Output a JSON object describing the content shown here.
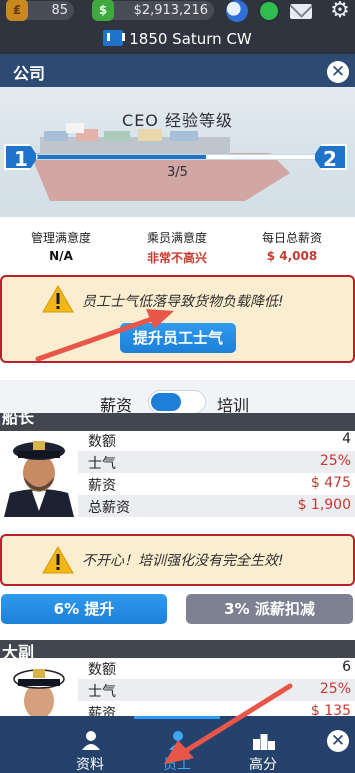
{
  "topbar": {
    "gold_amount": "85",
    "cash_amount": "$2,913,216",
    "icons": [
      "gold-icon",
      "cash-icon",
      "globe-icon",
      "status-icon",
      "mail-icon",
      "gear-icon"
    ]
  },
  "ship": {
    "name": "1850 Saturn CW"
  },
  "panel": {
    "title": "公司",
    "close_label": "✕"
  },
  "ceo": {
    "title": "CEO 经验等级",
    "level_current": "1",
    "level_next": "2",
    "progress_text": "3/5",
    "progress_fraction": 0.6
  },
  "stats": [
    {
      "label": "管理满意度",
      "value": "N/A",
      "color": "#111111"
    },
    {
      "label": "乘员满意度",
      "value": "非常不高兴",
      "color": "#c53a2f"
    },
    {
      "label": "每日总薪资",
      "value": "$ 4,008",
      "color": "#c53a2f"
    }
  ],
  "warning_top": {
    "text": "员工士气低落导致货物负载降低!",
    "button": "提升员工士气"
  },
  "toggle": {
    "left": "薪资",
    "right": "培训",
    "state": "left"
  },
  "captain": {
    "name": "船长",
    "rows": [
      {
        "label": "数额",
        "value": "4",
        "red": false
      },
      {
        "label": "士气",
        "value": "25%",
        "red": true
      },
      {
        "label": "薪资",
        "value": "$ 475",
        "red": true
      },
      {
        "label": "总薪资",
        "value": "$ 1,900",
        "red": true
      }
    ]
  },
  "warning_mid": {
    "text": "不开心！培训强化没有完全生效!"
  },
  "actions": {
    "boost": "6% 提升",
    "cut": "3% 派薪扣减"
  },
  "first_mate": {
    "name": "大副",
    "rows": [
      {
        "label": "数额",
        "value": "6",
        "red": false
      },
      {
        "label": "士气",
        "value": "25%",
        "red": true
      },
      {
        "label": "薪资",
        "value": "$ 135",
        "red": true
      }
    ]
  },
  "tabs": [
    {
      "label": "资料",
      "icon": "person-icon",
      "active": false
    },
    {
      "label": "员工",
      "icon": "crew-icon",
      "active": true
    },
    {
      "label": "高分",
      "icon": "podium-icon",
      "active": false
    }
  ],
  "colors": {
    "accent": "#1d7fd8",
    "header": "#2c4a72",
    "alert": "#b8202a",
    "negative": "#c53a2f"
  }
}
